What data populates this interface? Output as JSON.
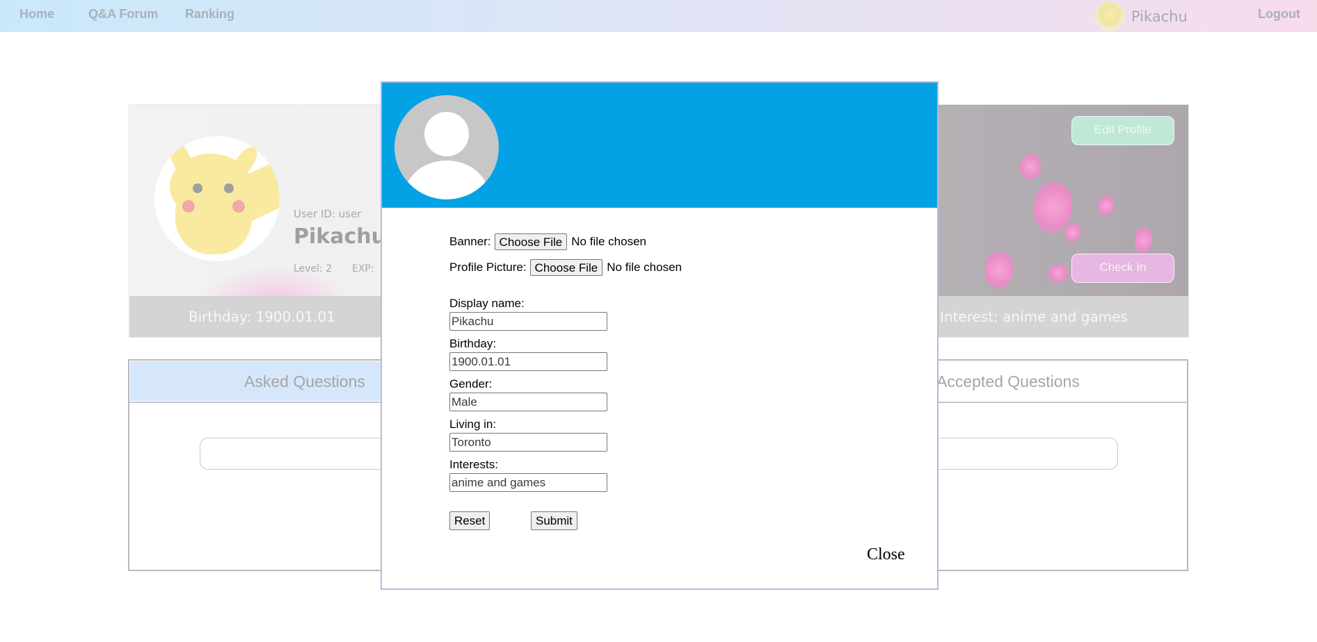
{
  "nav": {
    "home": "Home",
    "forum": "Q&A Forum",
    "ranking": "Ranking",
    "username": "Pikachu",
    "logout": "Logout"
  },
  "profile": {
    "user_id": "User ID: user",
    "name": "Pikachu",
    "level": "Level: 2",
    "exp": "EXP:",
    "edit_button": "Edit Profile",
    "checkin_button": "Check In",
    "birthday": "Birthday: 1900.01.01",
    "interest": "Interest: anime and games"
  },
  "questions": {
    "tab_asked": "Asked Questions",
    "tab_accepted": "Accepted Questions"
  },
  "modal": {
    "banner_label": "Banner:",
    "profile_picture_label": "Profile Picture:",
    "choose_file": "Choose File",
    "no_file": "No file chosen",
    "fields": {
      "display_name": {
        "label": "Display name:",
        "value": "Pikachu"
      },
      "birthday": {
        "label": "Birthday:",
        "value": "1900.01.01"
      },
      "gender": {
        "label": "Gender:",
        "value": "Male"
      },
      "living_in": {
        "label": "Living in:",
        "value": "Toronto"
      },
      "interests": {
        "label": "Interests:",
        "value": "anime and games"
      }
    },
    "reset": "Reset",
    "submit": "Submit",
    "close": "Close"
  },
  "colors": {
    "modal_banner": "#03a2e5",
    "edit_button": "#bfe9d6",
    "checkin_button": "#e7b6e3",
    "asked_tab": "#d6e7fb"
  },
  "icons": {
    "nav_avatar": "pikachu-avatar-icon",
    "profile_avatar": "pikachu-avatar-image",
    "modal_avatar": "default-user-icon"
  }
}
